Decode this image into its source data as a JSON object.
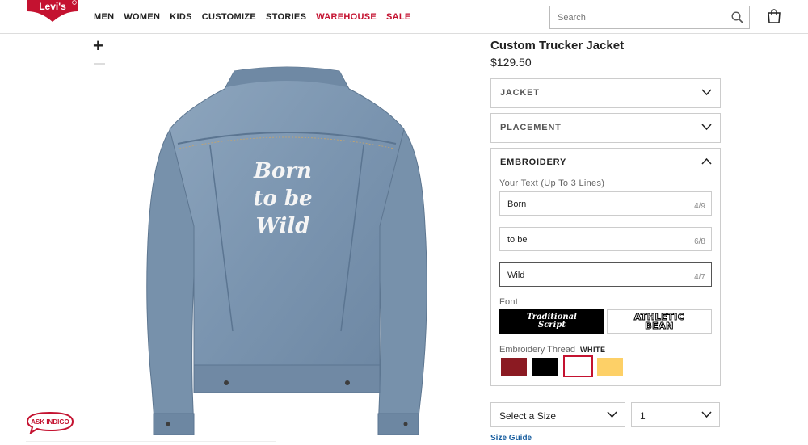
{
  "brand": {
    "logo_text": "Levi's",
    "accent": "#c41230"
  },
  "nav": {
    "items": [
      {
        "label": "MEN",
        "highlight": false
      },
      {
        "label": "WOMEN",
        "highlight": false
      },
      {
        "label": "KIDS",
        "highlight": false
      },
      {
        "label": "CUSTOMIZE",
        "highlight": false
      },
      {
        "label": "STORIES",
        "highlight": false
      },
      {
        "label": "WAREHOUSE",
        "highlight": true
      },
      {
        "label": "SALE",
        "highlight": true
      }
    ]
  },
  "search": {
    "placeholder": "Search",
    "icon": "search-icon"
  },
  "cart": {
    "icon": "shopping-bag-icon"
  },
  "gallery": {
    "zoom_in": "+",
    "embroidery_preview": [
      "Born",
      "to be",
      "Wild"
    ]
  },
  "chat": {
    "label": "ASK INDIGO"
  },
  "product": {
    "title": "Custom Trucker Jacket",
    "price": "$129.50"
  },
  "accordion": {
    "jacket": "JACKET",
    "placement": "PLACEMENT",
    "embroidery": "EMBROIDERY"
  },
  "embroidery": {
    "text_label": "Your Text (Up To 3 Lines)",
    "lines": [
      {
        "value": "Born",
        "count": "4/9"
      },
      {
        "value": "to be",
        "count": "6/8"
      },
      {
        "value": "Wild",
        "count": "4/7"
      }
    ],
    "font_label": "Font",
    "fonts": [
      {
        "label": "Traditional Script",
        "selected": true
      },
      {
        "label": "ATHLETIC BEAN",
        "selected": false
      }
    ],
    "thread_label": "Embroidery Thread",
    "thread_selected": "WHITE",
    "threads": [
      {
        "name": "red",
        "color": "#8b1a22"
      },
      {
        "name": "black",
        "color": "#000000"
      },
      {
        "name": "white",
        "color": "#ffffff"
      },
      {
        "name": "gold",
        "color": "#fdd067"
      }
    ]
  },
  "purchase": {
    "size_placeholder": "Select a Size",
    "quantity": "1",
    "size_guide": "Size Guide"
  }
}
